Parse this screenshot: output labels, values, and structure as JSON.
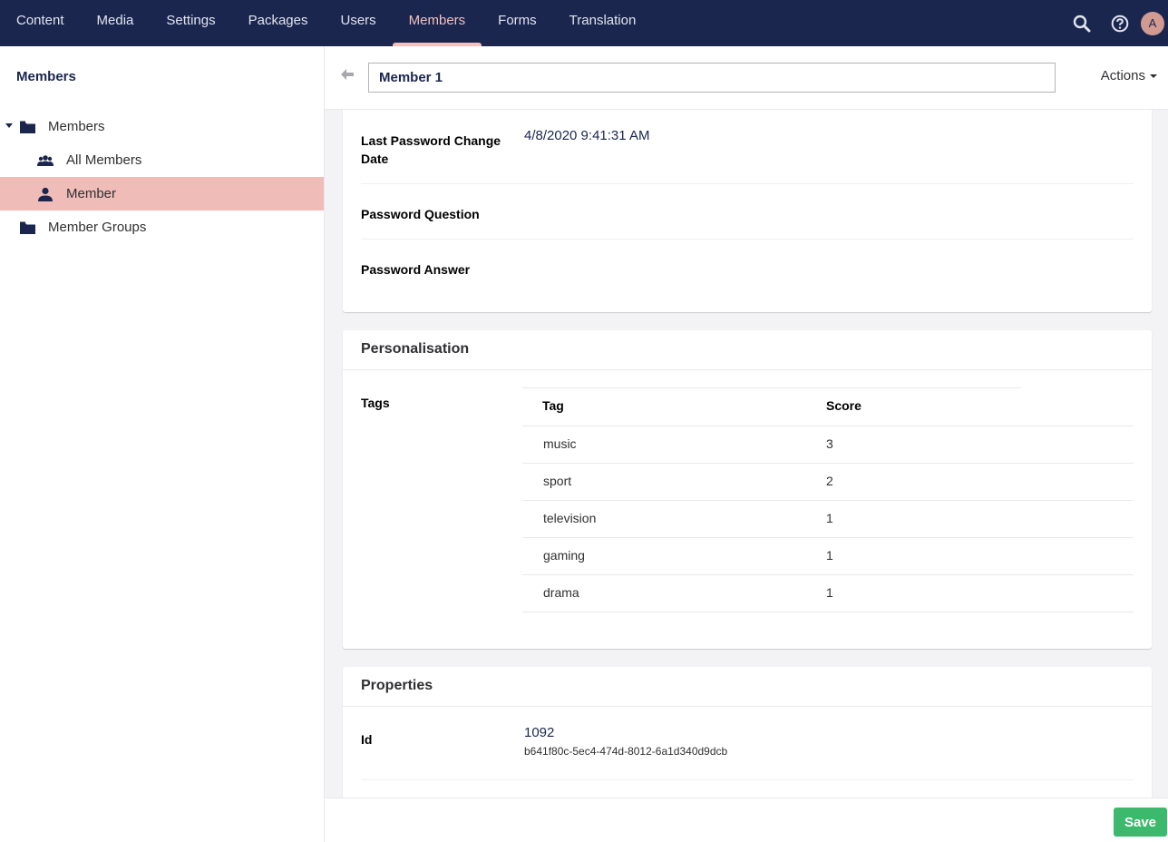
{
  "topnav": {
    "items": [
      {
        "label": "Content",
        "active": false
      },
      {
        "label": "Media",
        "active": false
      },
      {
        "label": "Settings",
        "active": false
      },
      {
        "label": "Packages",
        "active": false
      },
      {
        "label": "Users",
        "active": false
      },
      {
        "label": "Members",
        "active": true
      },
      {
        "label": "Forms",
        "active": false
      },
      {
        "label": "Translation",
        "active": false
      }
    ],
    "icons": [
      "search-icon",
      "help-icon"
    ],
    "avatar_initial": "A"
  },
  "sidebar": {
    "title": "Members",
    "tree": [
      {
        "label": "Members",
        "icon": "folder-icon",
        "expanded": true
      },
      {
        "label": "All Members",
        "icon": "users-icon"
      },
      {
        "label": "Member",
        "icon": "user-icon",
        "selected": true
      },
      {
        "label": "Member Groups",
        "icon": "folder-icon"
      }
    ]
  },
  "editor": {
    "name_value": "Member 1",
    "actions_label": "Actions"
  },
  "membership": {
    "rows": [
      {
        "label": "Last Password Change Date",
        "value": "4/8/2020 9:41:31 AM"
      },
      {
        "label": "Password Question",
        "value": ""
      },
      {
        "label": "Password Answer",
        "value": ""
      }
    ]
  },
  "personalisation": {
    "title": "Personalisation",
    "tags_label": "Tags",
    "columns": [
      "Tag",
      "Score"
    ],
    "rows": [
      {
        "tag": "music",
        "score": "3"
      },
      {
        "tag": "sport",
        "score": "2"
      },
      {
        "tag": "television",
        "score": "1"
      },
      {
        "tag": "gaming",
        "score": "1"
      },
      {
        "tag": "drama",
        "score": "1"
      }
    ]
  },
  "properties": {
    "title": "Properties",
    "id_label": "Id",
    "id_value": "1092",
    "guid_value": "b641f80c-5ec4-474d-8012-6a1d340d9dcb"
  },
  "footer": {
    "save_label": "Save"
  }
}
